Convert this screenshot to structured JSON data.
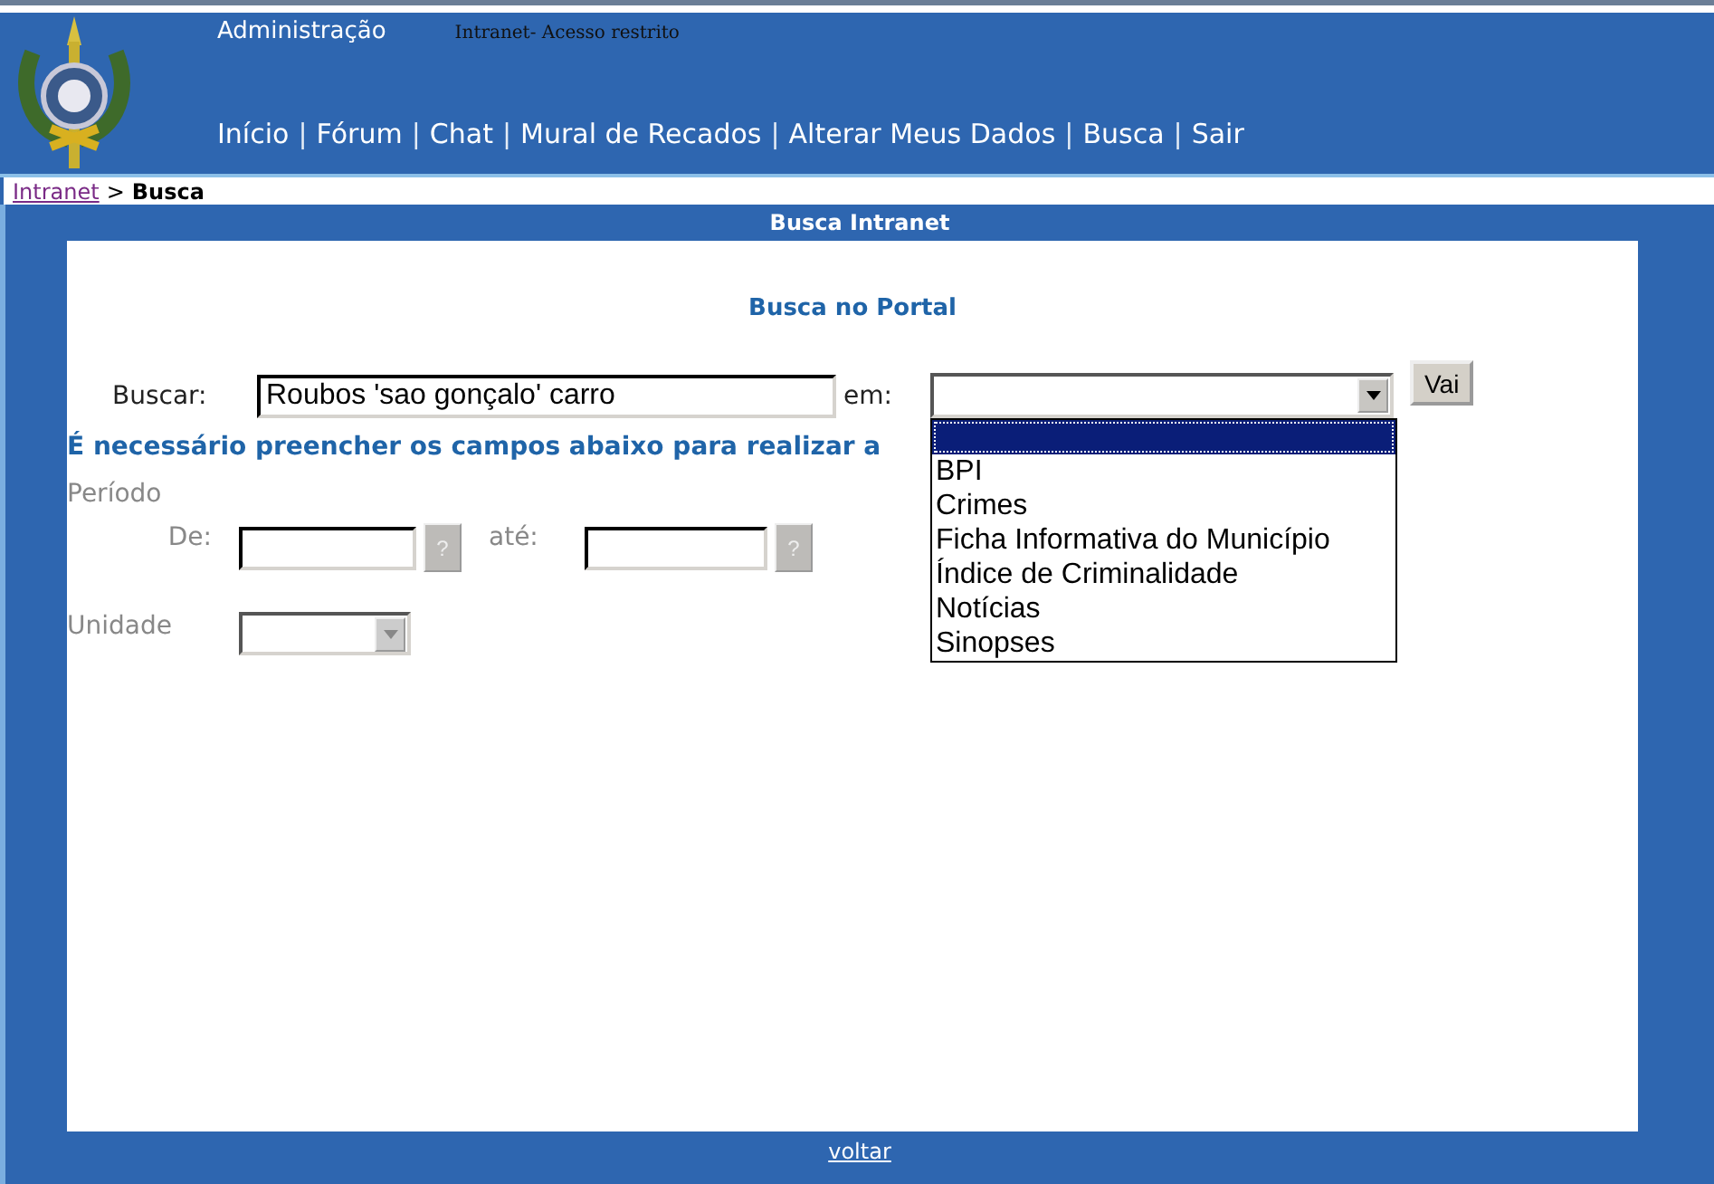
{
  "header": {
    "admin_link": "Administração",
    "notice": "Intranet- Acesso restrito",
    "nav": [
      {
        "kind": "link",
        "label": "Início"
      },
      {
        "kind": "separator",
        "label": "|"
      },
      {
        "kind": "link",
        "label": "Fórum"
      },
      {
        "kind": "separator",
        "label": "|"
      },
      {
        "kind": "link",
        "label": "Chat"
      },
      {
        "kind": "separator",
        "label": "|"
      },
      {
        "kind": "link",
        "label": "Mural de Recados"
      },
      {
        "kind": "separator",
        "label": "|"
      },
      {
        "kind": "link",
        "label": "Alterar Meus Dados"
      },
      {
        "kind": "separator",
        "label": "|"
      },
      {
        "kind": "link",
        "label": "Busca"
      },
      {
        "kind": "separator",
        "label": "|"
      },
      {
        "kind": "link",
        "label": "Sair"
      }
    ]
  },
  "breadcrumb": {
    "link": "Intranet",
    "separator": ">",
    "current": "Busca"
  },
  "panel": {
    "title": "Busca Intranet",
    "section_title": "Busca no Portal",
    "search": {
      "label": "Buscar:",
      "value": "Roubos 'sao gonçalo' carro",
      "in_label": "em:",
      "go_button": "Vai",
      "select": {
        "expanded": true,
        "options": [
          {
            "selected": true
          },
          {
            "label": "BPI",
            "selected": false
          },
          {
            "label": "Crimes",
            "selected": false
          },
          {
            "label": "Ficha Informativa do Município",
            "selected": false
          },
          {
            "label": "Índice de Criminalidade",
            "selected": false
          },
          {
            "label": "Notícias",
            "selected": false
          },
          {
            "label": "Sinopses",
            "selected": false
          }
        ]
      }
    },
    "message": "É necessário preencher os campos abaixo para realizar a",
    "period": {
      "label": "Período",
      "from_label": "De:",
      "from_help": "?",
      "to_label": "até:",
      "to_help": "?"
    },
    "unit": {
      "label": "Unidade"
    }
  },
  "footer": {
    "link": "voltar"
  }
}
